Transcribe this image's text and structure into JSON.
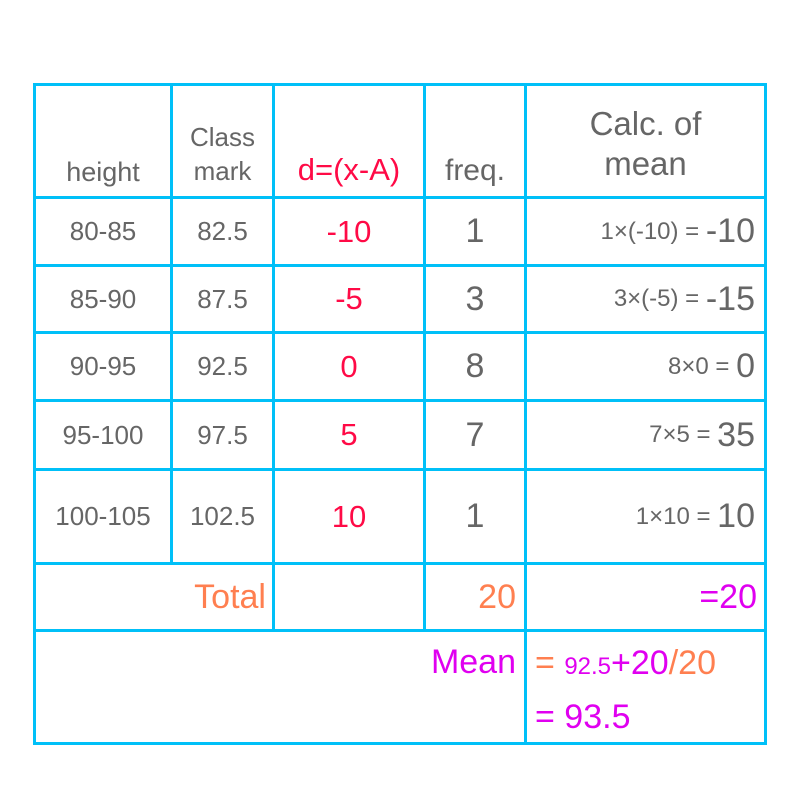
{
  "table": {
    "headers": {
      "height": "height",
      "class_mark_line1": "Class",
      "class_mark_line2": "mark",
      "deviation": "d=(x-A)",
      "frequency": "freq.",
      "calc_line1": "Calc. of",
      "calc_line2": "mean"
    },
    "rows": [
      {
        "height": "80-85",
        "class_mark": "82.5",
        "d": "-10",
        "freq": "1",
        "calc_expr": "1×(-10) = ",
        "calc_result": "-10"
      },
      {
        "height": "85-90",
        "class_mark": "87.5",
        "d": "-5",
        "freq": "3",
        "calc_expr": "3×(-5) = ",
        "calc_result": "-15"
      },
      {
        "height": "90-95",
        "class_mark": "92.5",
        "d": "0",
        "freq": "8",
        "calc_expr": "8×0 = ",
        "calc_result": "0"
      },
      {
        "height": "95-100",
        "class_mark": "97.5",
        "d": "5",
        "freq": "7",
        "calc_expr": "7×5 = ",
        "calc_result": "35"
      },
      {
        "height": "100-105",
        "class_mark": "102.5",
        "d": "10",
        "freq": "1",
        "calc_expr": "1×10 = ",
        "calc_result": "10"
      }
    ],
    "total": {
      "label": "Total",
      "freq_total": "20",
      "calc_total": "=20"
    },
    "mean": {
      "label": "Mean",
      "eq1": "=",
      "assumed_mean": "92.5",
      "plus": "+",
      "numerator": "20",
      "divider": "/",
      "denominator": "20",
      "result_line": "= 93.5"
    }
  },
  "colors": {
    "grid": "#00c0f8",
    "text": "#666666",
    "deviation": "#ff0a46",
    "total": "#ff7f50",
    "mean": "#e000f0"
  }
}
